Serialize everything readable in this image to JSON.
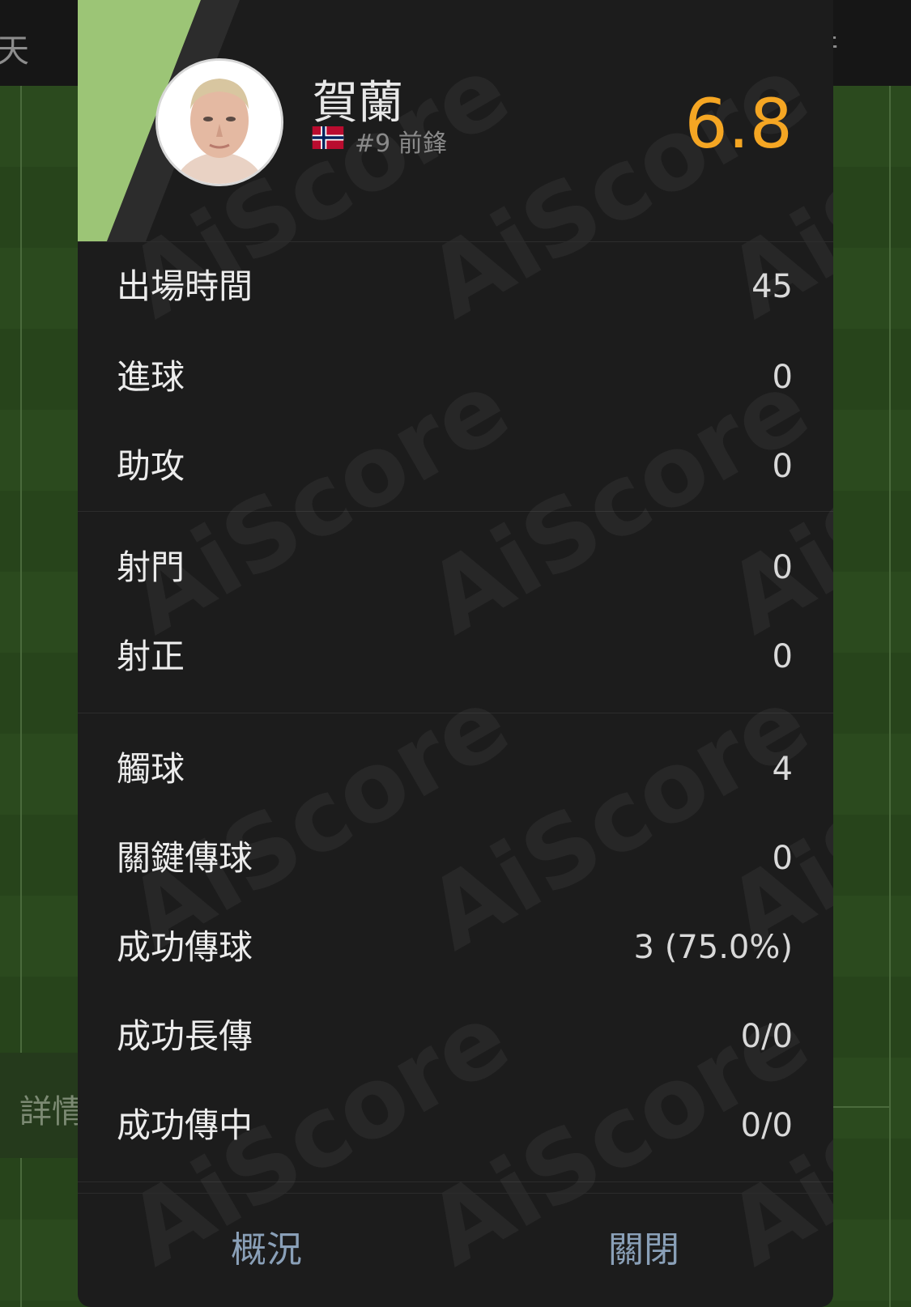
{
  "background": {
    "top_left_text": "天",
    "top_right_text": "行",
    "details_tab": "詳情"
  },
  "player": {
    "name": "賀蘭",
    "meta": "#9 前鋒",
    "flag_icon": "norway-flag-icon",
    "rating": "6.8"
  },
  "sections": [
    {
      "rows": [
        {
          "label": "出場時間",
          "value": "45"
        },
        {
          "label": "進球",
          "value": "0"
        },
        {
          "label": "助攻",
          "value": "0"
        }
      ]
    },
    {
      "rows": [
        {
          "label": "射門",
          "value": "0"
        },
        {
          "label": "射正",
          "value": "0"
        }
      ]
    },
    {
      "rows": [
        {
          "label": "觸球",
          "value": "4"
        },
        {
          "label": "關鍵傳球",
          "value": "0"
        },
        {
          "label": "成功傳球",
          "value": "3 (75.0%)"
        },
        {
          "label": "成功長傳",
          "value": "0/0"
        },
        {
          "label": "成功傳中",
          "value": "0/0"
        }
      ]
    }
  ],
  "footer": {
    "overview_label": "概況",
    "close_label": "關閉"
  },
  "watermark_text": "AiScore",
  "colors": {
    "rating": "#f5a623",
    "accent_stripe": "#9cc576",
    "footer_text": "#8aa0b8"
  }
}
